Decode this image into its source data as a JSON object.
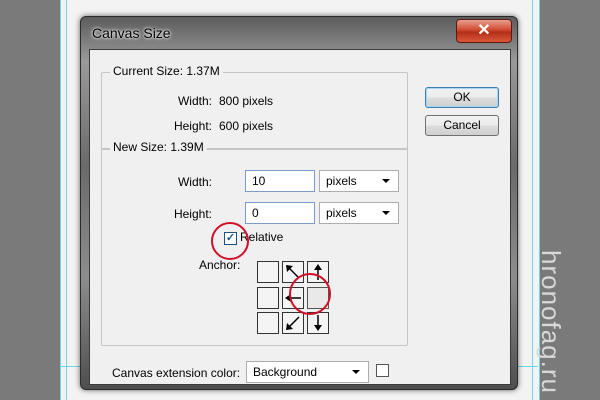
{
  "dialog": {
    "title": "Canvas Size",
    "close_symbol": "✕"
  },
  "current_size": {
    "legend": "Current Size: 1.37M",
    "width_label": "Width:",
    "width_value": "800 pixels",
    "height_label": "Height:",
    "height_value": "600 pixels"
  },
  "new_size": {
    "legend": "New Size: 1.39M",
    "width_label": "Width:",
    "width_value": "10",
    "width_unit": "pixels",
    "height_label": "Height:",
    "height_value": "0",
    "height_unit": "pixels",
    "relative_label": "Relative",
    "relative_checked": true,
    "anchor_label": "Anchor:"
  },
  "anchor": {
    "selected": "middle-right",
    "arrows": [
      "none",
      "up-left",
      "up",
      "none",
      "left",
      "none",
      "none",
      "down-left",
      "down"
    ]
  },
  "extension": {
    "label": "Canvas extension color:",
    "value": "Background",
    "swatch_color": "#ffffff"
  },
  "buttons": {
    "ok": "OK",
    "cancel": "Cancel"
  },
  "watermark": "hronofag.ru",
  "colors": {
    "highlight": "#d0102a",
    "guide": "#6fd6e2"
  }
}
